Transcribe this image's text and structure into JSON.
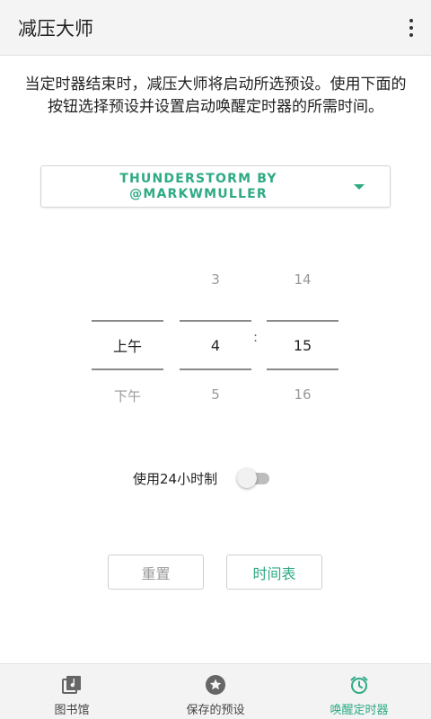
{
  "appbar": {
    "title": "减压大师",
    "menu_icon": "more-vert-icon"
  },
  "description": "当定时器结束时，减压大师将启动所选预设。使用下面的按钮选择预设并设置启动唤醒定时器的所需时间。",
  "preset": {
    "selected_line1": "THUNDERSTORM BY",
    "selected_line2": "@MARKWMULLER",
    "caret_icon": "dropdown-caret-icon"
  },
  "time_picker": {
    "ampm": {
      "prev": "",
      "current": "上午",
      "next": "下午"
    },
    "hour": {
      "prev": "3",
      "current": "4",
      "next": "5"
    },
    "separator": ":",
    "minute": {
      "prev": "14",
      "current": "15",
      "next": "16"
    }
  },
  "toggle_24h": {
    "label": "使用24小时制",
    "enabled": false
  },
  "buttons": {
    "reset": "重置",
    "schedule": "时间表"
  },
  "bottom_nav": [
    {
      "label": "图书馆",
      "icon": "music-library-icon",
      "active": false
    },
    {
      "label": "保存的预设",
      "icon": "star-icon",
      "active": false
    },
    {
      "label": "唤醒定时器",
      "icon": "alarm-clock-icon",
      "active": true
    }
  ],
  "colors": {
    "accent": "#2eaa84",
    "appbar_bg": "#f4f4f4",
    "nav_bg": "#f3f3f3"
  }
}
